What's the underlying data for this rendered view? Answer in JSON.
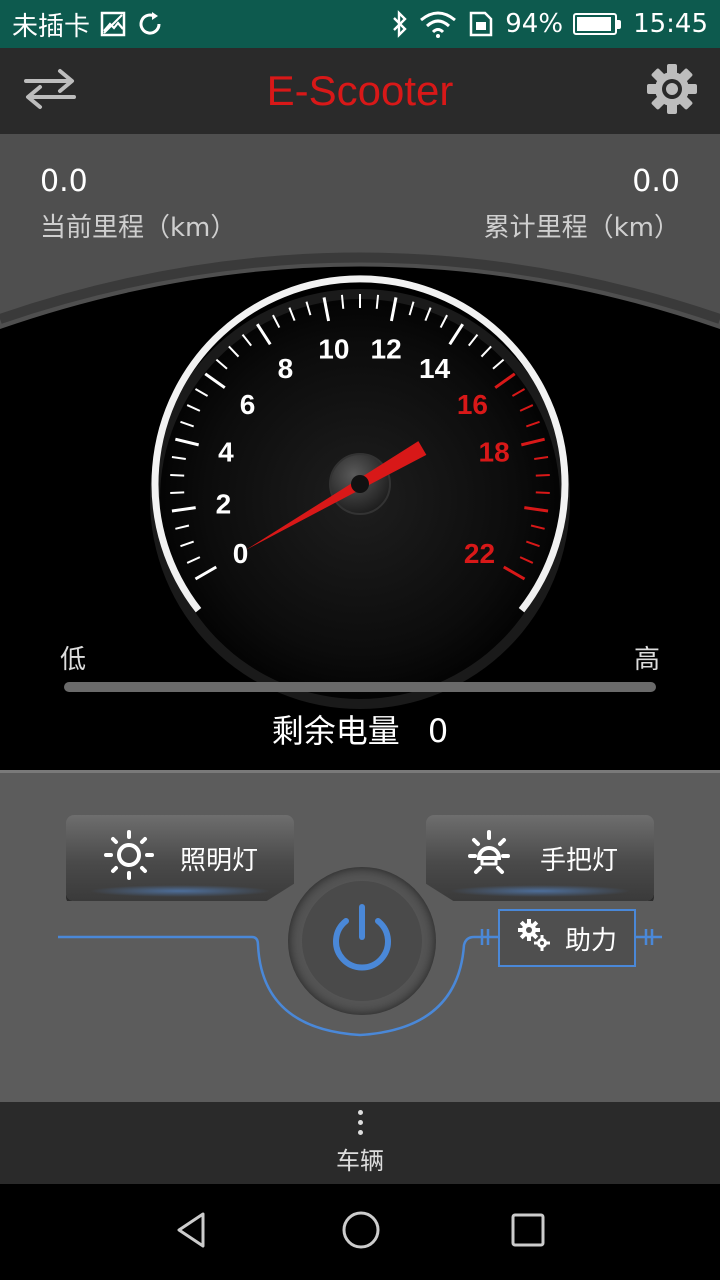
{
  "status_bar": {
    "carrier": "未插卡",
    "battery_percent": "94%",
    "battery_level": 0.94,
    "time": "15:45",
    "icons": [
      "sim-image-icon",
      "sync-icon",
      "bluetooth-icon",
      "wifi-icon",
      "sim-data-icon",
      "battery-icon"
    ]
  },
  "header": {
    "title": "E-Scooter",
    "left_icon": "swap-arrows-icon",
    "right_icon": "gear-icon",
    "title_color": "#d81818"
  },
  "trip": {
    "current_value": "0.0",
    "current_label": "当前里程（km）",
    "total_value": "0.0",
    "total_label": "累计里程（km）"
  },
  "speedometer": {
    "min": 0,
    "max": 22,
    "speed": 0,
    "labels": [
      "0",
      "2",
      "4",
      "6",
      "8",
      "10",
      "12",
      "14",
      "16",
      "18",
      "22"
    ],
    "label_values": [
      0,
      2,
      4,
      6,
      8,
      10,
      12,
      14,
      16,
      18,
      22
    ],
    "red_from": 16,
    "normal_color": "#ffffff",
    "red_color": "#d81818",
    "needle_color": "#d81818"
  },
  "battery": {
    "low_label": "低",
    "high_label": "高",
    "remaining_label": "剩余电量",
    "remaining_value": "0",
    "level": 0
  },
  "controls": {
    "light_label": "照明灯",
    "handle_light_label": "手把灯",
    "assist_label": "助力",
    "accent_color": "#4a88d8"
  },
  "tab": {
    "label": "车辆"
  }
}
